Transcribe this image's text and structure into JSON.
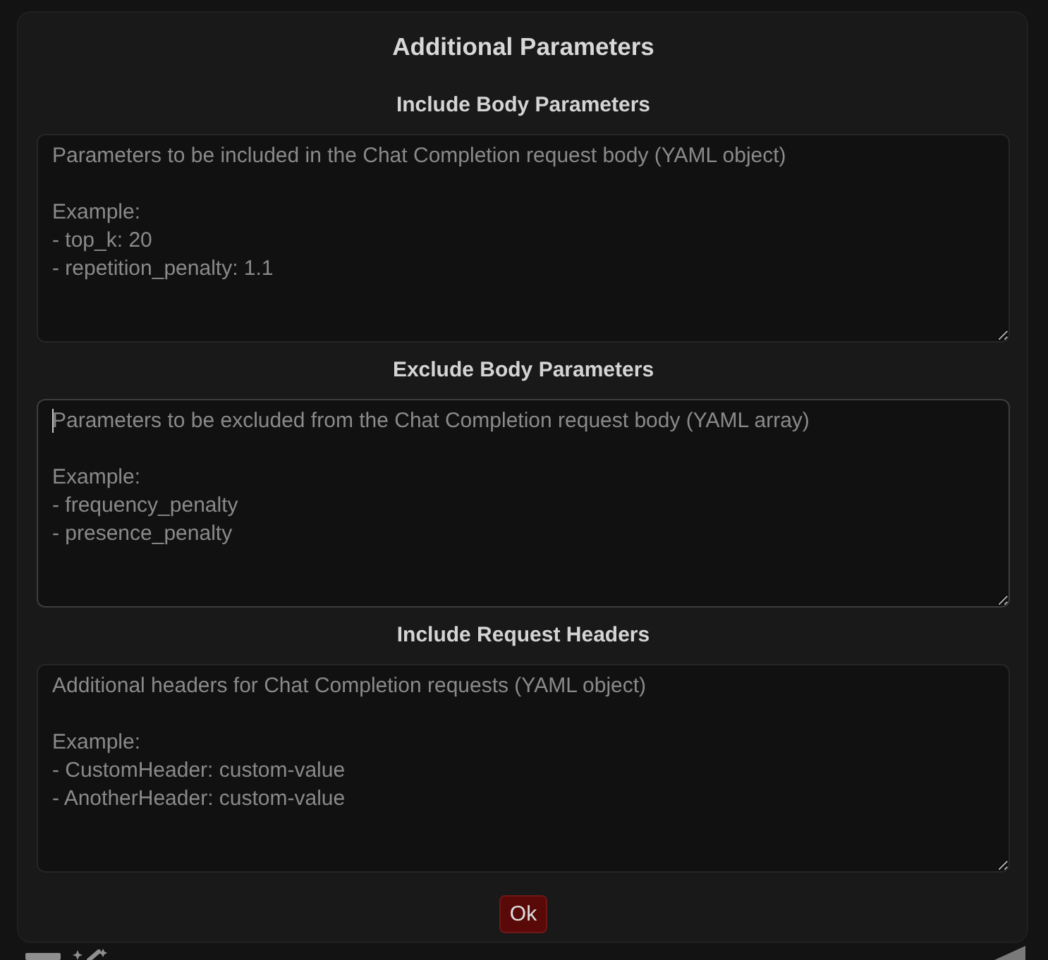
{
  "dialog": {
    "title": "Additional Parameters",
    "sections": [
      {
        "heading": "Include Body Parameters",
        "field": {
          "placeholder": "Parameters to be included in the Chat Completion request body (YAML object)\n\nExample:\n- top_k: 20\n- repetition_penalty: 1.1",
          "focused": false
        }
      },
      {
        "heading": "Exclude Body Parameters",
        "field": {
          "placeholder": "Parameters to be excluded from the Chat Completion request body (YAML array)\n\nExample:\n- frequency_penalty\n- presence_penalty",
          "focused": true
        }
      },
      {
        "heading": "Include Request Headers",
        "field": {
          "placeholder": "Additional headers for Chat Completion requests (YAML object)\n\nExample:\n- CustomHeader: custom-value\n- AnotherHeader: custom-value",
          "focused": false
        }
      }
    ],
    "buttons": [
      {
        "label": "Ok"
      }
    ]
  }
}
